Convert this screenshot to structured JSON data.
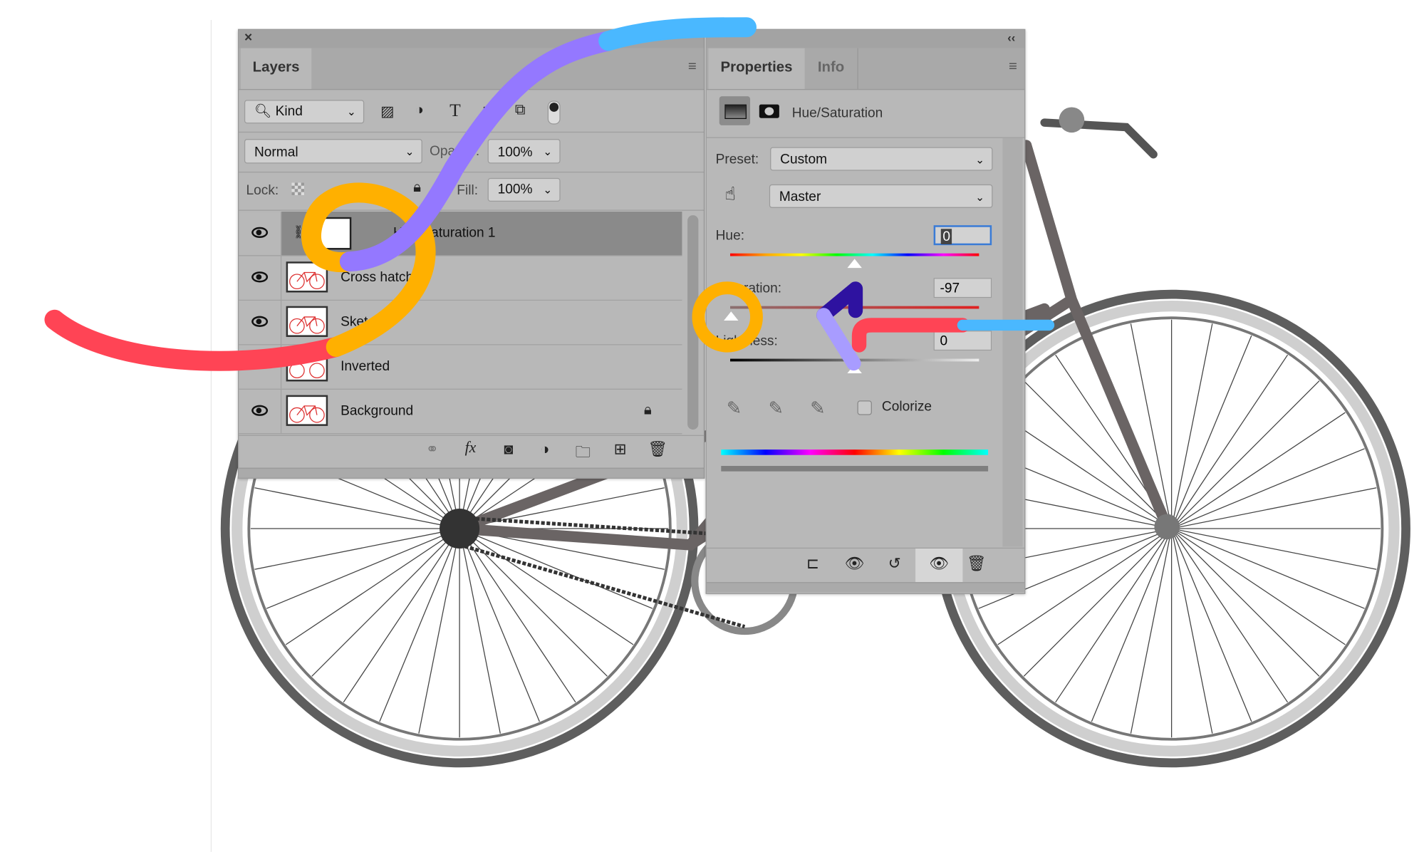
{
  "layers_panel": {
    "close_glyph": "×",
    "tab": "Layers",
    "filter": {
      "label": "Kind",
      "icons": [
        "image-filter-icon",
        "adjustment-filter-icon",
        "type-filter-icon",
        "shape-filter-icon",
        "smart-object-filter-icon",
        "filter-toggle-icon"
      ]
    },
    "blend_mode": "Normal",
    "opacity_label": "Opacity:",
    "opacity_value": "100%",
    "lock_label": "Lock:",
    "fill_label": "Fill:",
    "fill_value": "100%",
    "layers": [
      {
        "name": "Hue/Saturation 1",
        "visible": true,
        "selected": true,
        "type": "adjustment"
      },
      {
        "name": "Cross hatch",
        "visible": true,
        "selected": false
      },
      {
        "name": "Sketch",
        "visible": true,
        "selected": false
      },
      {
        "name": "Inverted",
        "visible": false,
        "selected": false
      },
      {
        "name": "Background",
        "visible": true,
        "selected": false,
        "locked": true
      }
    ],
    "footer_icons": [
      "link-layers-icon",
      "fx-icon",
      "add-mask-icon",
      "new-adjustment-icon",
      "new-group-icon",
      "new-layer-icon",
      "delete-layer-icon"
    ]
  },
  "properties_panel": {
    "collapse_glyph": "‹‹",
    "tabs": [
      "Properties",
      "Info"
    ],
    "adjustment_title": "Hue/Saturation",
    "preset_label": "Preset:",
    "preset_value": "Custom",
    "channel_value": "Master",
    "hue_label": "Hue:",
    "hue_value": "0",
    "saturation_label": "Saturation:",
    "saturation_value": "-97",
    "lightness_label": "Lightness:",
    "lightness_value": "0",
    "colorize_label": "Colorize",
    "colorize_checked": false
  },
  "annotation_colors": {
    "red": "#ff4455",
    "orange": "#ffb000",
    "purple": "#9478ff",
    "blue": "#4ab8ff",
    "indigo": "#2e12a0",
    "lavender": "#a89cff"
  }
}
